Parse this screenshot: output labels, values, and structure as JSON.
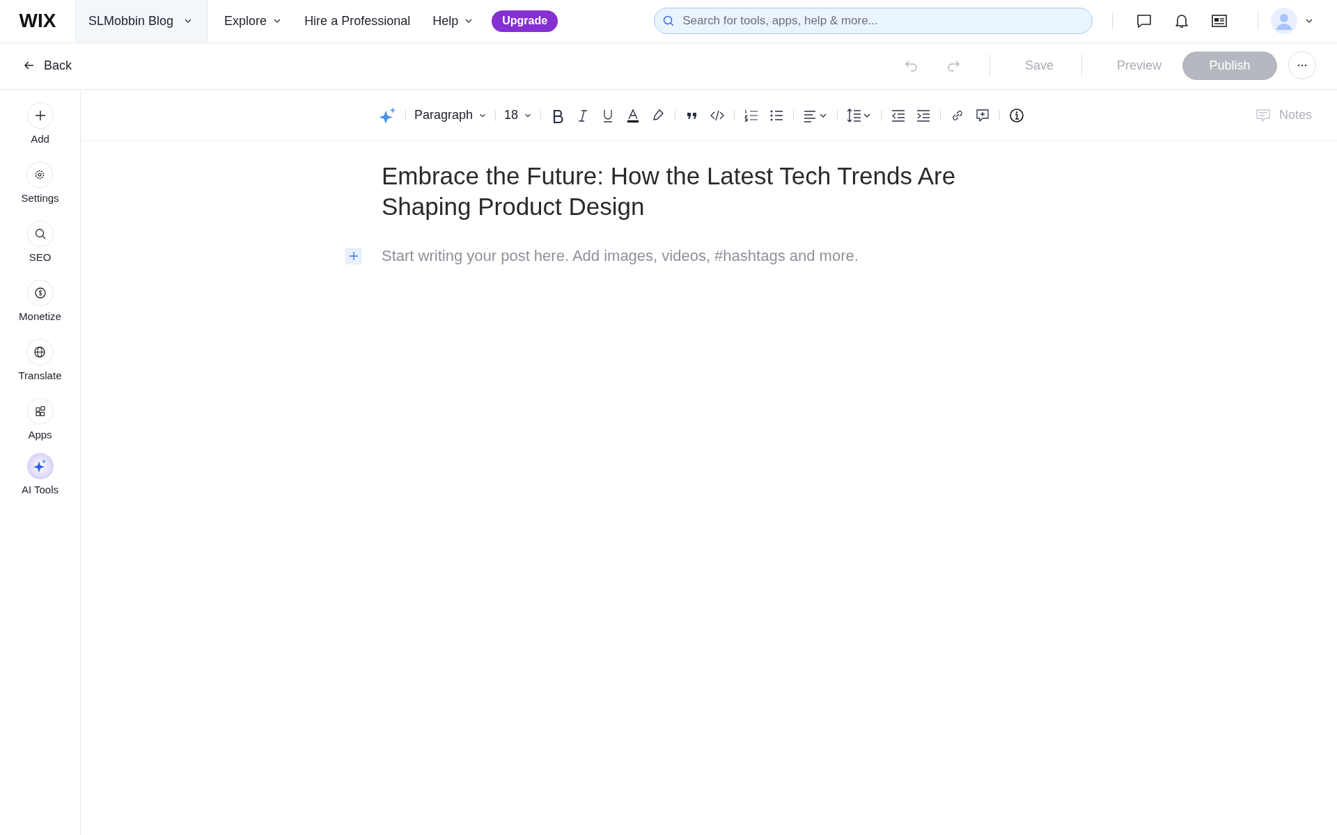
{
  "logo": "WIX",
  "site": {
    "label": "SLMobbin Blog",
    "selected": true
  },
  "nav": [
    {
      "label": "Explore",
      "dropdown": true
    },
    {
      "label": "Hire a Professional",
      "dropdown": false
    },
    {
      "label": "Help",
      "dropdown": true
    }
  ],
  "upgrade": "Upgrade",
  "search": {
    "placeholder": "Search for tools, apps, help & more..."
  },
  "back": "Back",
  "actions": {
    "save": {
      "label": "Save",
      "disabled": true
    },
    "preview": {
      "label": "Preview",
      "disabled": true
    },
    "publish": {
      "label": "Publish",
      "disabled": true
    }
  },
  "sidebar": [
    {
      "label": "Add",
      "kind": "add"
    },
    {
      "label": "Settings",
      "kind": "settings"
    },
    {
      "label": "SEO",
      "kind": "seo"
    },
    {
      "label": "Monetize",
      "kind": "monetize"
    },
    {
      "label": "Translate",
      "kind": "translate"
    },
    {
      "label": "Apps",
      "kind": "apps"
    },
    {
      "label": "AI Tools",
      "kind": "ai"
    }
  ],
  "toolbar": {
    "style": "Paragraph",
    "size": "18",
    "notes": "Notes"
  },
  "post": {
    "title": "Embrace the Future: How the Latest Tech Trends Are Shaping Product Design",
    "placeholder": "Start writing your post here. Add images, videos, #hashtags and more."
  }
}
